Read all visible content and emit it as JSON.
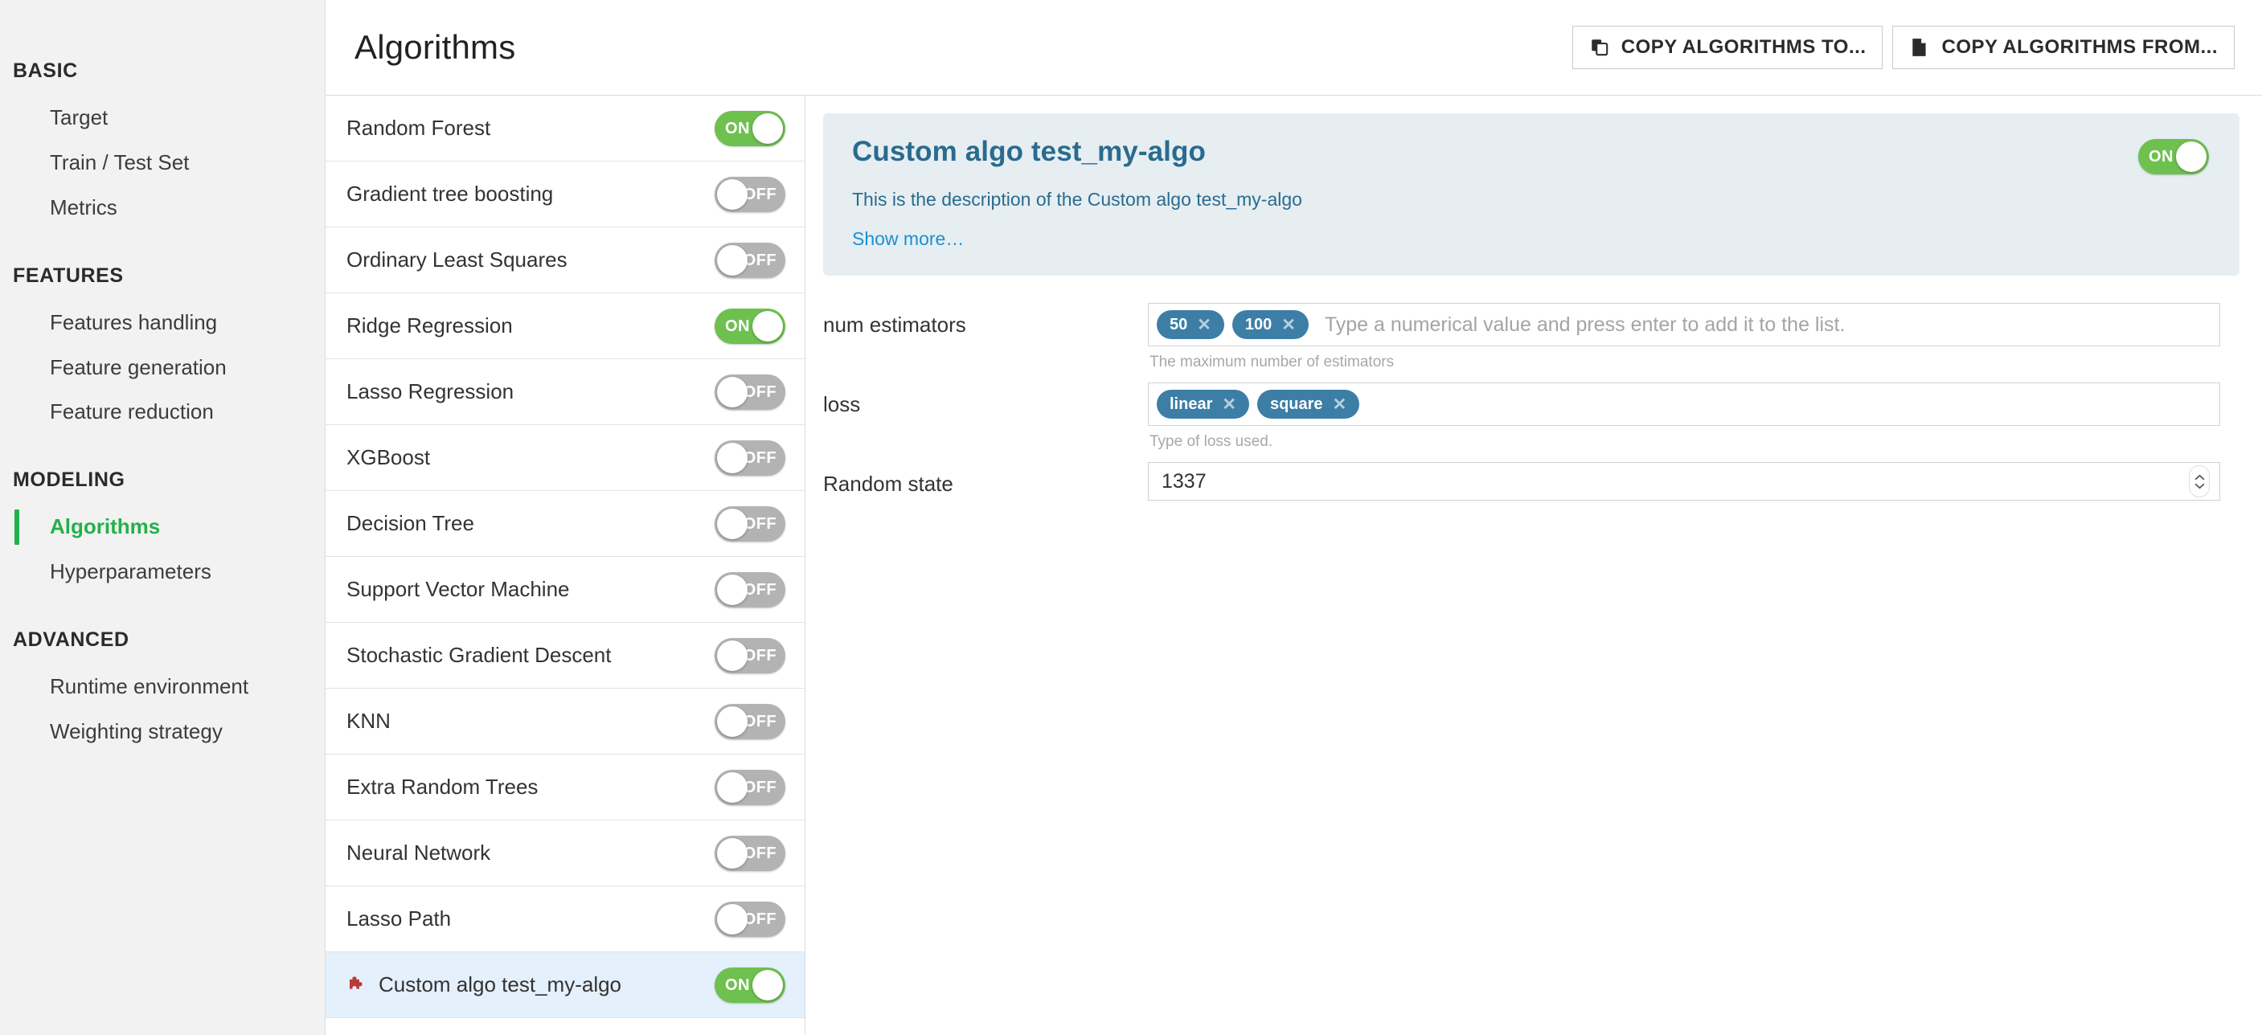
{
  "sidebar": {
    "sections": [
      {
        "title": "BASIC",
        "items": [
          {
            "label": "Target",
            "active": false
          },
          {
            "label": "Train / Test Set",
            "active": false
          },
          {
            "label": "Metrics",
            "active": false
          }
        ]
      },
      {
        "title": "FEATURES",
        "items": [
          {
            "label": "Features handling",
            "active": false
          },
          {
            "label": "Feature generation",
            "active": false
          },
          {
            "label": "Feature reduction",
            "active": false
          }
        ]
      },
      {
        "title": "MODELING",
        "items": [
          {
            "label": "Algorithms",
            "active": true
          },
          {
            "label": "Hyperparameters",
            "active": false
          }
        ]
      },
      {
        "title": "ADVANCED",
        "items": [
          {
            "label": "Runtime environment",
            "active": false
          },
          {
            "label": "Weighting strategy",
            "active": false
          }
        ]
      }
    ]
  },
  "header": {
    "title": "Algorithms",
    "copy_to_label": "COPY ALGORITHMS TO...",
    "copy_from_label": "COPY ALGORITHMS FROM..."
  },
  "algorithms": [
    {
      "name": "Random Forest",
      "state": "ON",
      "selected": false,
      "custom": false
    },
    {
      "name": "Gradient tree boosting",
      "state": "OFF",
      "selected": false,
      "custom": false
    },
    {
      "name": "Ordinary Least Squares",
      "state": "OFF",
      "selected": false,
      "custom": false
    },
    {
      "name": "Ridge Regression",
      "state": "ON",
      "selected": false,
      "custom": false
    },
    {
      "name": "Lasso Regression",
      "state": "OFF",
      "selected": false,
      "custom": false
    },
    {
      "name": "XGBoost",
      "state": "OFF",
      "selected": false,
      "custom": false
    },
    {
      "name": "Decision Tree",
      "state": "OFF",
      "selected": false,
      "custom": false
    },
    {
      "name": "Support Vector Machine",
      "state": "OFF",
      "selected": false,
      "custom": false
    },
    {
      "name": "Stochastic Gradient Descent",
      "state": "OFF",
      "selected": false,
      "custom": false
    },
    {
      "name": "KNN",
      "state": "OFF",
      "selected": false,
      "custom": false
    },
    {
      "name": "Extra Random Trees",
      "state": "OFF",
      "selected": false,
      "custom": false
    },
    {
      "name": "Neural Network",
      "state": "OFF",
      "selected": false,
      "custom": false
    },
    {
      "name": "Lasso Path",
      "state": "OFF",
      "selected": false,
      "custom": false
    },
    {
      "name": "Custom algo test_my-algo",
      "state": "ON",
      "selected": true,
      "custom": true
    }
  ],
  "detail": {
    "title": "Custom algo test_my-algo",
    "description": "This is the description of the Custom algo test_my-algo",
    "show_more_label": "Show more…",
    "toggle_state": "ON",
    "fields": [
      {
        "label": "num estimators",
        "type": "tags",
        "tags": [
          "50",
          "100"
        ],
        "placeholder": "Type a numerical value and press enter to add it to the list.",
        "help": "The maximum number of estimators"
      },
      {
        "label": "loss",
        "type": "tags",
        "tags": [
          "linear",
          "square"
        ],
        "placeholder": "",
        "help": "Type of loss used."
      },
      {
        "label": "Random state",
        "type": "number",
        "value": "1337",
        "help": ""
      }
    ]
  },
  "colors": {
    "accent_green": "#24b04b",
    "toggle_on": "#6ec04f",
    "toggle_off": "#b3b3b3",
    "chip_blue": "#3d7ea6",
    "detail_bg": "#e6eef1",
    "detail_text": "#2a6b8f",
    "link_blue": "#1a8fd6",
    "selected_row": "#e4f0fb",
    "puzzle_red": "#b93a3a"
  }
}
